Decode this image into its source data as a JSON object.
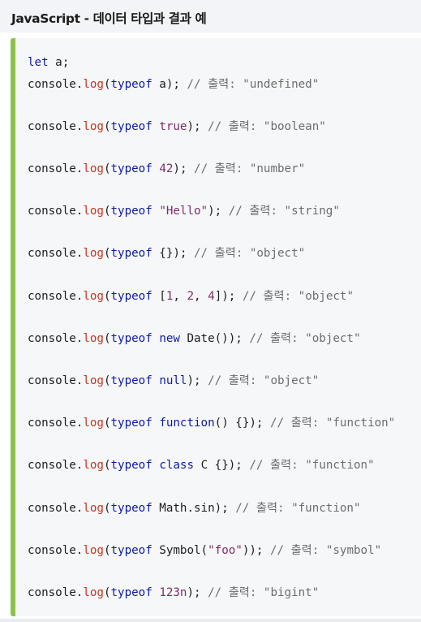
{
  "header": {
    "title": "JavaScript - 데이터 타입과 결과 예"
  },
  "code": {
    "accent_color": "#8cc24a",
    "lines": [
      {
        "tokens": [
          {
            "t": "let",
            "c": "kw"
          },
          {
            "t": " a;",
            "c": "plain"
          }
        ]
      },
      {
        "tokens": [
          {
            "t": "console.",
            "c": "plain"
          },
          {
            "t": "log",
            "c": "fn"
          },
          {
            "t": "(",
            "c": "plain"
          },
          {
            "t": "typeof",
            "c": "kw"
          },
          {
            "t": " a); ",
            "c": "plain"
          },
          {
            "t": "// 출력: \"undefined\"",
            "c": "cm"
          }
        ]
      },
      {
        "tokens": [
          {
            "t": "console.",
            "c": "plain"
          },
          {
            "t": "log",
            "c": "fn"
          },
          {
            "t": "(",
            "c": "plain"
          },
          {
            "t": "typeof",
            "c": "kw"
          },
          {
            "t": " ",
            "c": "plain"
          },
          {
            "t": "true",
            "c": "val"
          },
          {
            "t": "); ",
            "c": "plain"
          },
          {
            "t": "// 출력: \"boolean\"",
            "c": "cm"
          }
        ]
      },
      {
        "tokens": [
          {
            "t": "console.",
            "c": "plain"
          },
          {
            "t": "log",
            "c": "fn"
          },
          {
            "t": "(",
            "c": "plain"
          },
          {
            "t": "typeof",
            "c": "kw"
          },
          {
            "t": " ",
            "c": "plain"
          },
          {
            "t": "42",
            "c": "val"
          },
          {
            "t": "); ",
            "c": "plain"
          },
          {
            "t": "// 출력: \"number\"",
            "c": "cm"
          }
        ]
      },
      {
        "tokens": [
          {
            "t": "console.",
            "c": "plain"
          },
          {
            "t": "log",
            "c": "fn"
          },
          {
            "t": "(",
            "c": "plain"
          },
          {
            "t": "typeof",
            "c": "kw"
          },
          {
            "t": " ",
            "c": "plain"
          },
          {
            "t": "\"Hello\"",
            "c": "str"
          },
          {
            "t": "); ",
            "c": "plain"
          },
          {
            "t": "// 출력: \"string\"",
            "c": "cm"
          }
        ]
      },
      {
        "tokens": [
          {
            "t": "console.",
            "c": "plain"
          },
          {
            "t": "log",
            "c": "fn"
          },
          {
            "t": "(",
            "c": "plain"
          },
          {
            "t": "typeof",
            "c": "kw"
          },
          {
            "t": " {}); ",
            "c": "plain"
          },
          {
            "t": "// 출력: \"object\"",
            "c": "cm"
          }
        ]
      },
      {
        "tokens": [
          {
            "t": "console.",
            "c": "plain"
          },
          {
            "t": "log",
            "c": "fn"
          },
          {
            "t": "(",
            "c": "plain"
          },
          {
            "t": "typeof",
            "c": "kw"
          },
          {
            "t": " [",
            "c": "plain"
          },
          {
            "t": "1",
            "c": "val"
          },
          {
            "t": ", ",
            "c": "plain"
          },
          {
            "t": "2",
            "c": "val"
          },
          {
            "t": ", ",
            "c": "plain"
          },
          {
            "t": "4",
            "c": "val"
          },
          {
            "t": "]); ",
            "c": "plain"
          },
          {
            "t": "// 출력: \"object\"",
            "c": "cm"
          }
        ]
      },
      {
        "tokens": [
          {
            "t": "console.",
            "c": "plain"
          },
          {
            "t": "log",
            "c": "fn"
          },
          {
            "t": "(",
            "c": "plain"
          },
          {
            "t": "typeof",
            "c": "kw"
          },
          {
            "t": " ",
            "c": "plain"
          },
          {
            "t": "new",
            "c": "kw"
          },
          {
            "t": " Date()); ",
            "c": "plain"
          },
          {
            "t": "// 출력: \"object\"",
            "c": "cm"
          }
        ]
      },
      {
        "tokens": [
          {
            "t": "console.",
            "c": "plain"
          },
          {
            "t": "log",
            "c": "fn"
          },
          {
            "t": "(",
            "c": "plain"
          },
          {
            "t": "typeof",
            "c": "kw"
          },
          {
            "t": " ",
            "c": "plain"
          },
          {
            "t": "null",
            "c": "kw"
          },
          {
            "t": "); ",
            "c": "plain"
          },
          {
            "t": "// 출력: \"object\"",
            "c": "cm"
          }
        ]
      },
      {
        "tokens": [
          {
            "t": "console.",
            "c": "plain"
          },
          {
            "t": "log",
            "c": "fn"
          },
          {
            "t": "(",
            "c": "plain"
          },
          {
            "t": "typeof",
            "c": "kw"
          },
          {
            "t": " ",
            "c": "plain"
          },
          {
            "t": "function",
            "c": "kw"
          },
          {
            "t": "() {}); ",
            "c": "plain"
          },
          {
            "t": "// 출력: \"function\"",
            "c": "cm"
          }
        ]
      },
      {
        "tokens": [
          {
            "t": "console.",
            "c": "plain"
          },
          {
            "t": "log",
            "c": "fn"
          },
          {
            "t": "(",
            "c": "plain"
          },
          {
            "t": "typeof",
            "c": "kw"
          },
          {
            "t": " ",
            "c": "plain"
          },
          {
            "t": "class",
            "c": "kw"
          },
          {
            "t": " C {}); ",
            "c": "plain"
          },
          {
            "t": "// 출력: \"function\"",
            "c": "cm"
          }
        ]
      },
      {
        "tokens": [
          {
            "t": "console.",
            "c": "plain"
          },
          {
            "t": "log",
            "c": "fn"
          },
          {
            "t": "(",
            "c": "plain"
          },
          {
            "t": "typeof",
            "c": "kw"
          },
          {
            "t": " Math.sin); ",
            "c": "plain"
          },
          {
            "t": "// 출력: \"function\"",
            "c": "cm"
          }
        ]
      },
      {
        "tokens": [
          {
            "t": "console.",
            "c": "plain"
          },
          {
            "t": "log",
            "c": "fn"
          },
          {
            "t": "(",
            "c": "plain"
          },
          {
            "t": "typeof",
            "c": "kw"
          },
          {
            "t": " Symbol(",
            "c": "plain"
          },
          {
            "t": "\"foo\"",
            "c": "str"
          },
          {
            "t": ")); ",
            "c": "plain"
          },
          {
            "t": "// 출력: \"symbol\"",
            "c": "cm"
          }
        ]
      },
      {
        "tokens": [
          {
            "t": "console.",
            "c": "plain"
          },
          {
            "t": "log",
            "c": "fn"
          },
          {
            "t": "(",
            "c": "plain"
          },
          {
            "t": "typeof",
            "c": "kw"
          },
          {
            "t": " ",
            "c": "plain"
          },
          {
            "t": "123n",
            "c": "val"
          },
          {
            "t": "); ",
            "c": "plain"
          },
          {
            "t": "// 출력: \"bigint\"",
            "c": "cm"
          }
        ]
      }
    ]
  }
}
